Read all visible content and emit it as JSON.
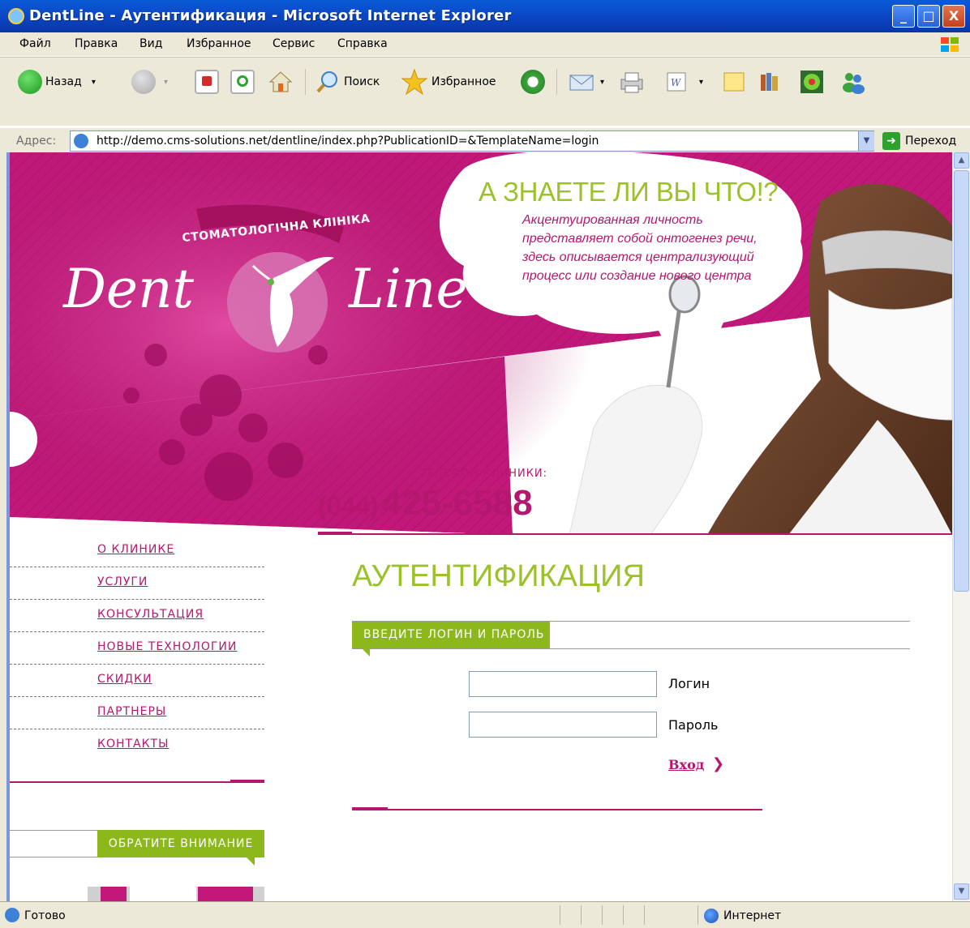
{
  "window": {
    "title": "DentLine - Аутентификация - Microsoft Internet Explorer",
    "minimize": "_",
    "maximize": "□",
    "close": "X"
  },
  "menu": [
    "Файл",
    "Правка",
    "Вид",
    "Избранное",
    "Сервис",
    "Справка"
  ],
  "toolbar": {
    "back_label": "Назад",
    "search_label": "Поиск",
    "favorites_label": "Избранное",
    "dropdown_glyph": "▾"
  },
  "address": {
    "label": "Адрес:",
    "url": "http://demo.cms-solutions.net/dentline/index.php?PublicationID=&TemplateName=login",
    "go_label": "Переход",
    "go_arrow": "➜",
    "dropdown_glyph": "▼"
  },
  "header": {
    "bubble_title": "А ЗНАЕТЕ ЛИ ВЫ ЧТО!?",
    "bubble_text": "Акцентуированная личность представляет собой онтогенез речи, здесь описывается централизующий процесс или создание нового центра",
    "logo_caption": "СТОМАТОЛОГІЧНА КЛІНІКА",
    "logo_dent": "Dent",
    "logo_line": "Line",
    "phone_label": "ТЕЛЕФОН КЛИНИКИ:",
    "phone_code": "(044)",
    "phone_number": "425-6588"
  },
  "nav": {
    "items": [
      {
        "label": "О КЛИНИКЕ"
      },
      {
        "label": "УСЛУГИ"
      },
      {
        "label": "КОНСУЛЬТАЦИЯ"
      },
      {
        "label": "НОВЫЕ ТЕХНОЛОГИИ"
      },
      {
        "label": "СКИДКИ"
      },
      {
        "label": "ПАРТНЕРЫ"
      },
      {
        "label": "КОНТАКТЫ"
      }
    ],
    "attention_label": "ОБРАТИТЕ ВНИМАНИЕ"
  },
  "main": {
    "page_title": "АУТЕНТИФИКАЦИЯ",
    "tab_label": "ВВЕДИТЕ ЛОГИН И ПАРОЛЬ",
    "login_label": "Логин",
    "login_value": "",
    "password_label": "Пароль",
    "password_value": "",
    "submit_label": "Вход",
    "submit_arrow": "❯"
  },
  "statusbar": {
    "status": "Готово",
    "zone": "Интернет"
  },
  "scrollbar": {
    "up_glyph": "▲",
    "down_glyph": "▼"
  },
  "colors": {
    "accent_magenta": "#b5176e",
    "accent_green": "#8cb81c",
    "header_bg": "#c2187a",
    "title_bar": "#0a46c4"
  }
}
